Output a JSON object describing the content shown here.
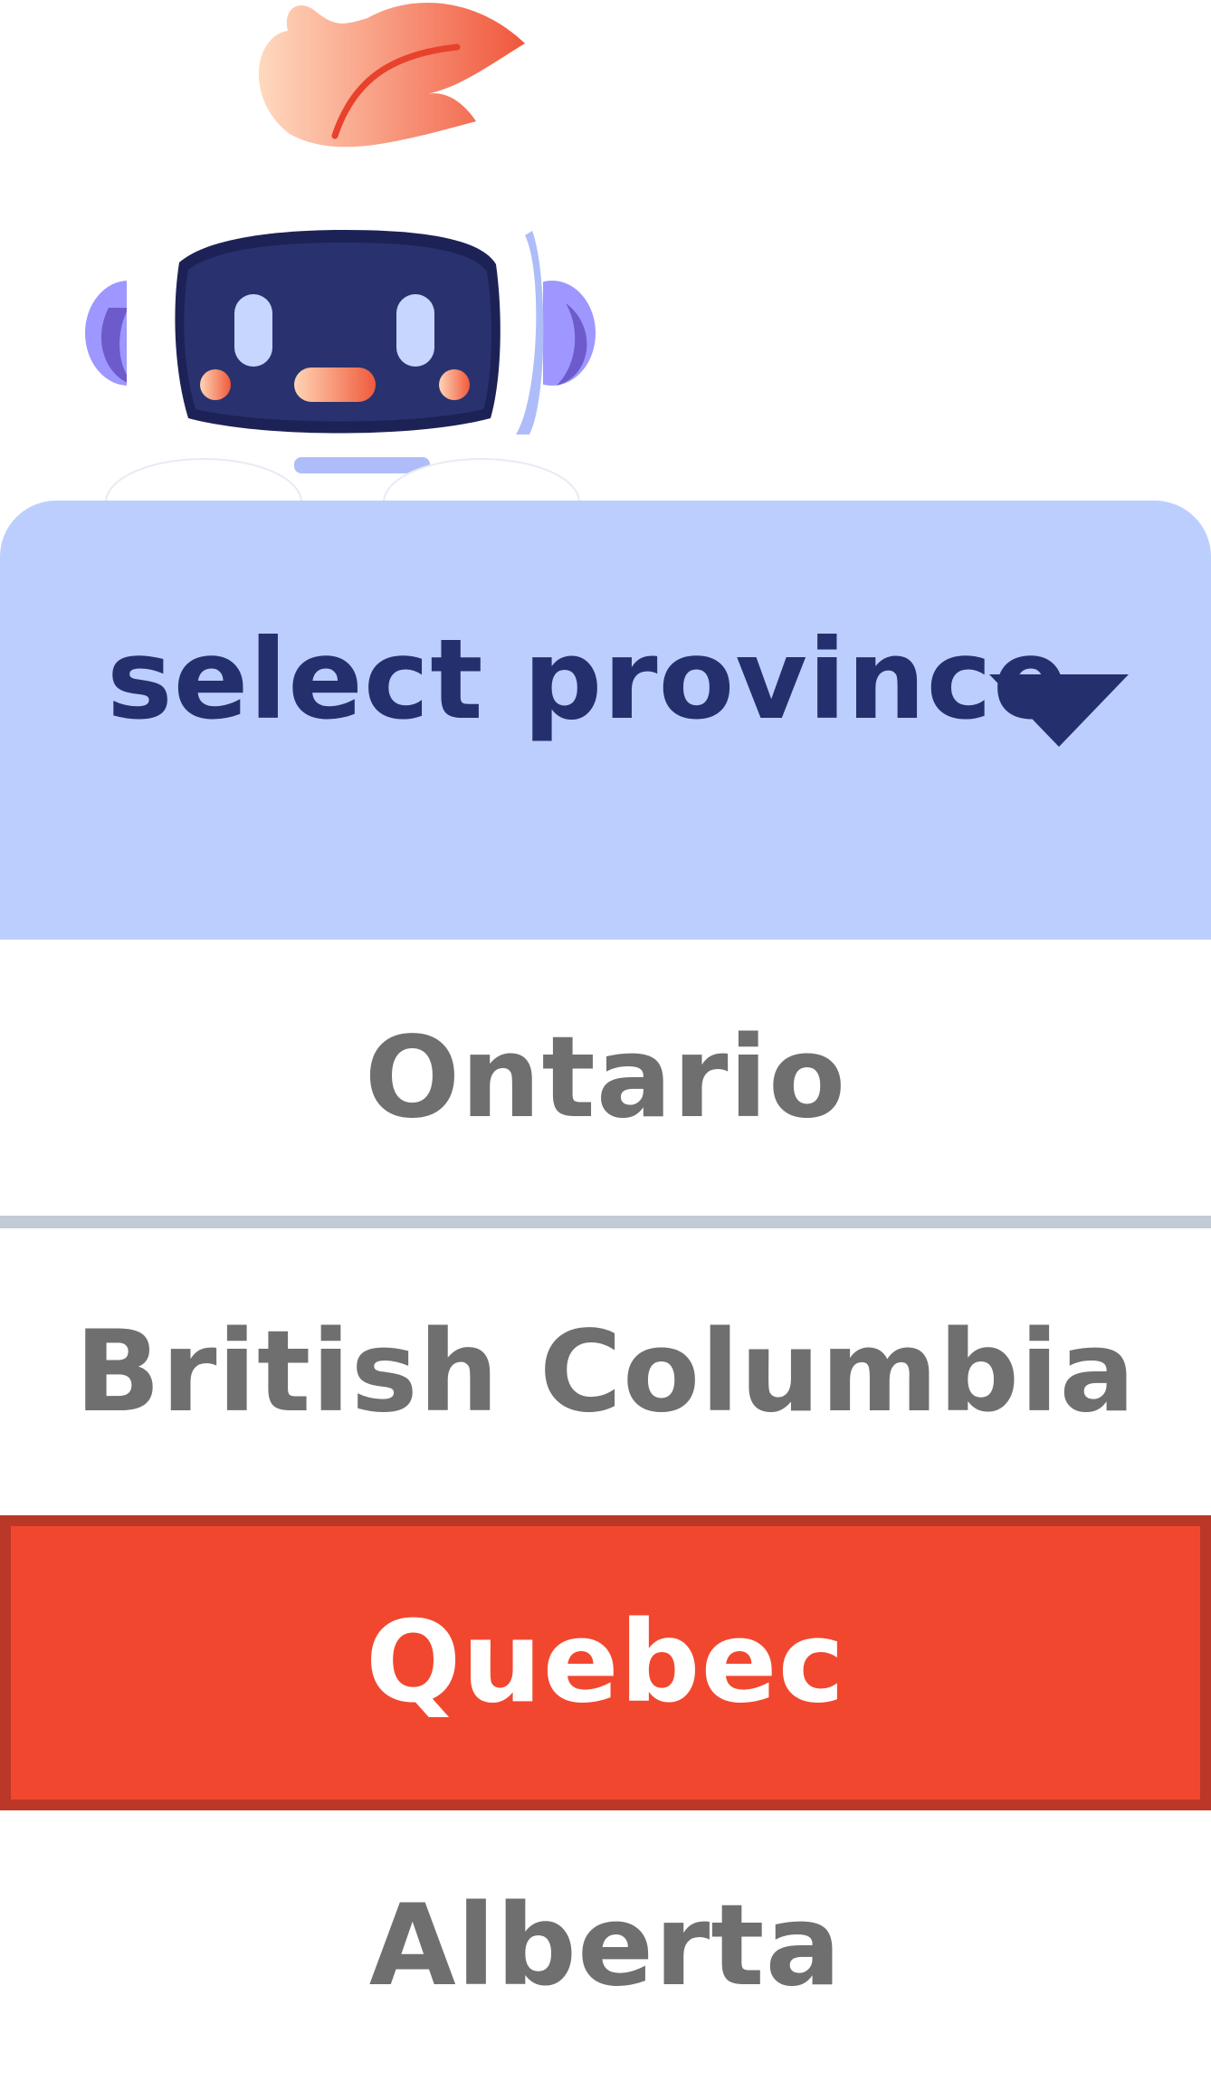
{
  "dropdown": {
    "placeholder": "select province",
    "arrow_icon": "triangle-down-icon",
    "options": [
      {
        "label": "Ontario",
        "selected": false
      },
      {
        "label": "British Columbia",
        "selected": false
      },
      {
        "label": "Quebec",
        "selected": true
      },
      {
        "label": "Alberta",
        "selected": false
      }
    ]
  },
  "colors": {
    "header_bg": "#bccefd",
    "header_text": "#24306e",
    "option_text": "#6f6f6f",
    "selected_bg": "#f2472f",
    "selected_border": "#bb3728",
    "divider": "#c2cad6"
  },
  "mascot": {
    "icon": "robot-mascot-with-leaf"
  }
}
